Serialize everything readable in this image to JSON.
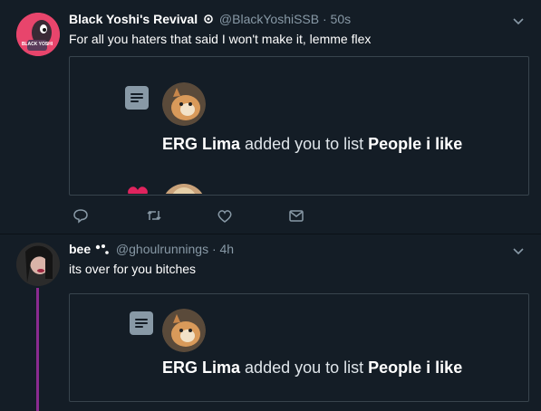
{
  "tweet1": {
    "name": "Black Yoshi's Revival",
    "handle_time": "@BlackYoshiSSB · 50s",
    "text": "For all you haters that said I won't make it, lemme flex",
    "avatar_text": "BLACK YOSHI",
    "embedded": {
      "actor": "ERG Lima",
      "action": "added you to list",
      "list": "People i like"
    }
  },
  "tweet2": {
    "name": "bee",
    "handle_time": "@ghoulrunnings · 4h",
    "text": "its over for you bitches",
    "embedded": {
      "actor": "ERG Lima",
      "action": "added you to list",
      "list": "People i like"
    }
  },
  "colors": {
    "background": "#141d26",
    "card_border": "#38444d",
    "muted": "#8899a6",
    "thread_line": "#8a2b8f",
    "heart": "#e0245e"
  },
  "icons": [
    "list-icon",
    "reply-icon",
    "retweet-icon",
    "like-icon",
    "dm-icon",
    "chevron-down-icon",
    "heart-icon"
  ]
}
